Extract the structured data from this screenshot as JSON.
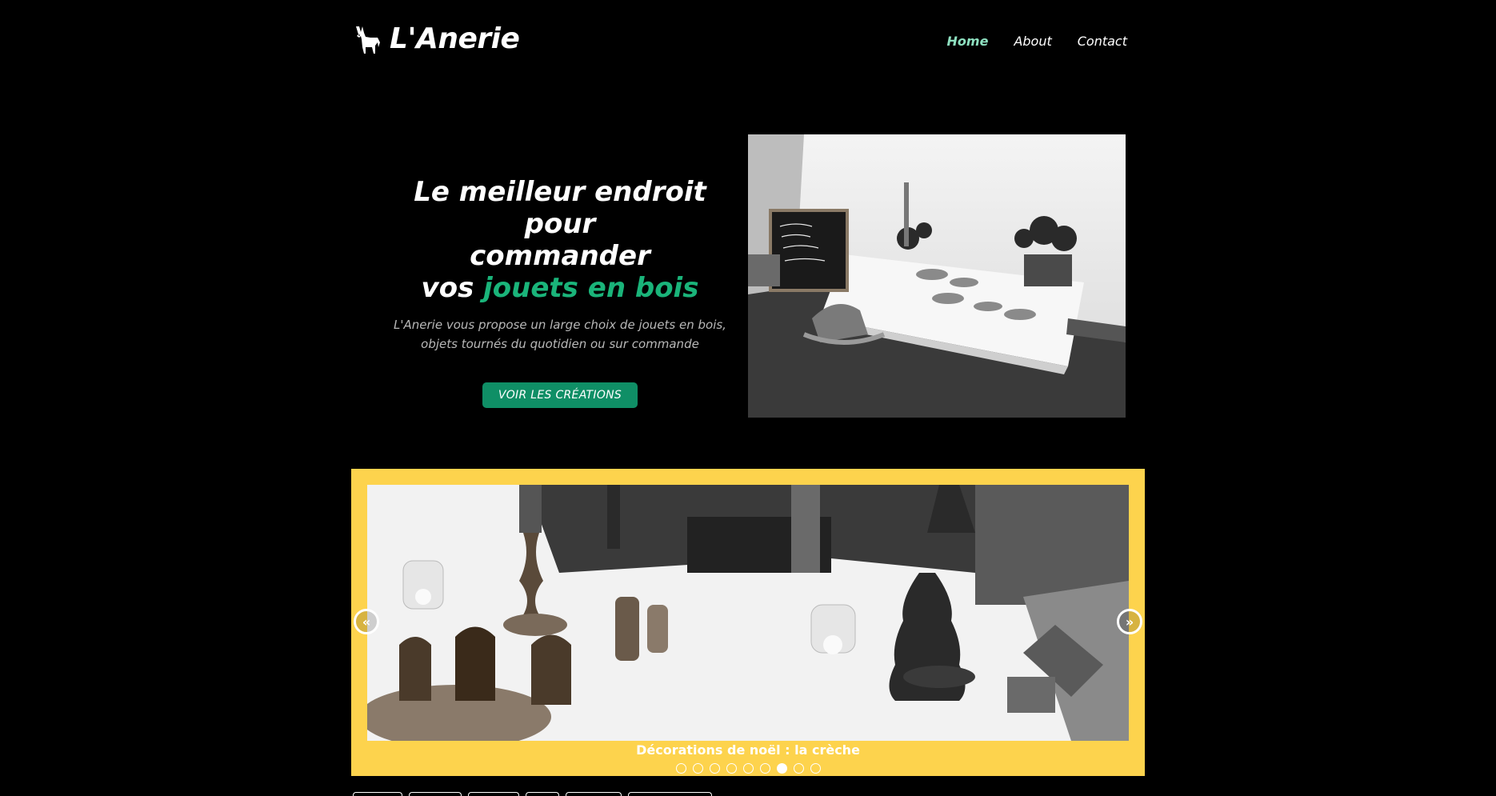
{
  "header": {
    "brand_name": "L'Anerie",
    "logo_icon": "donkey-icon",
    "nav": [
      {
        "label": "Home",
        "active": true
      },
      {
        "label": "About",
        "active": false
      },
      {
        "label": "Contact",
        "active": false
      }
    ]
  },
  "hero": {
    "title_line1": "Le meilleur endroit pour",
    "title_line2": "commander",
    "title_line3_prefix": "vos ",
    "title_line3_accent": "jouets en bois",
    "subtitle": "L'Anerie vous propose un large choix de jouets en bois, objets tournés du quotidien ou sur commande",
    "cta_label": "VOIR LES CRÉATIONS",
    "accent_color": "#1ab47a"
  },
  "carousel": {
    "caption": "Décorations de noël : la crèche",
    "prev_icon": "chevron-left-double-icon",
    "next_icon": "chevron-right-double-icon",
    "slide_count": 9,
    "active_index": 6,
    "frame_color": "#fdd34d"
  }
}
